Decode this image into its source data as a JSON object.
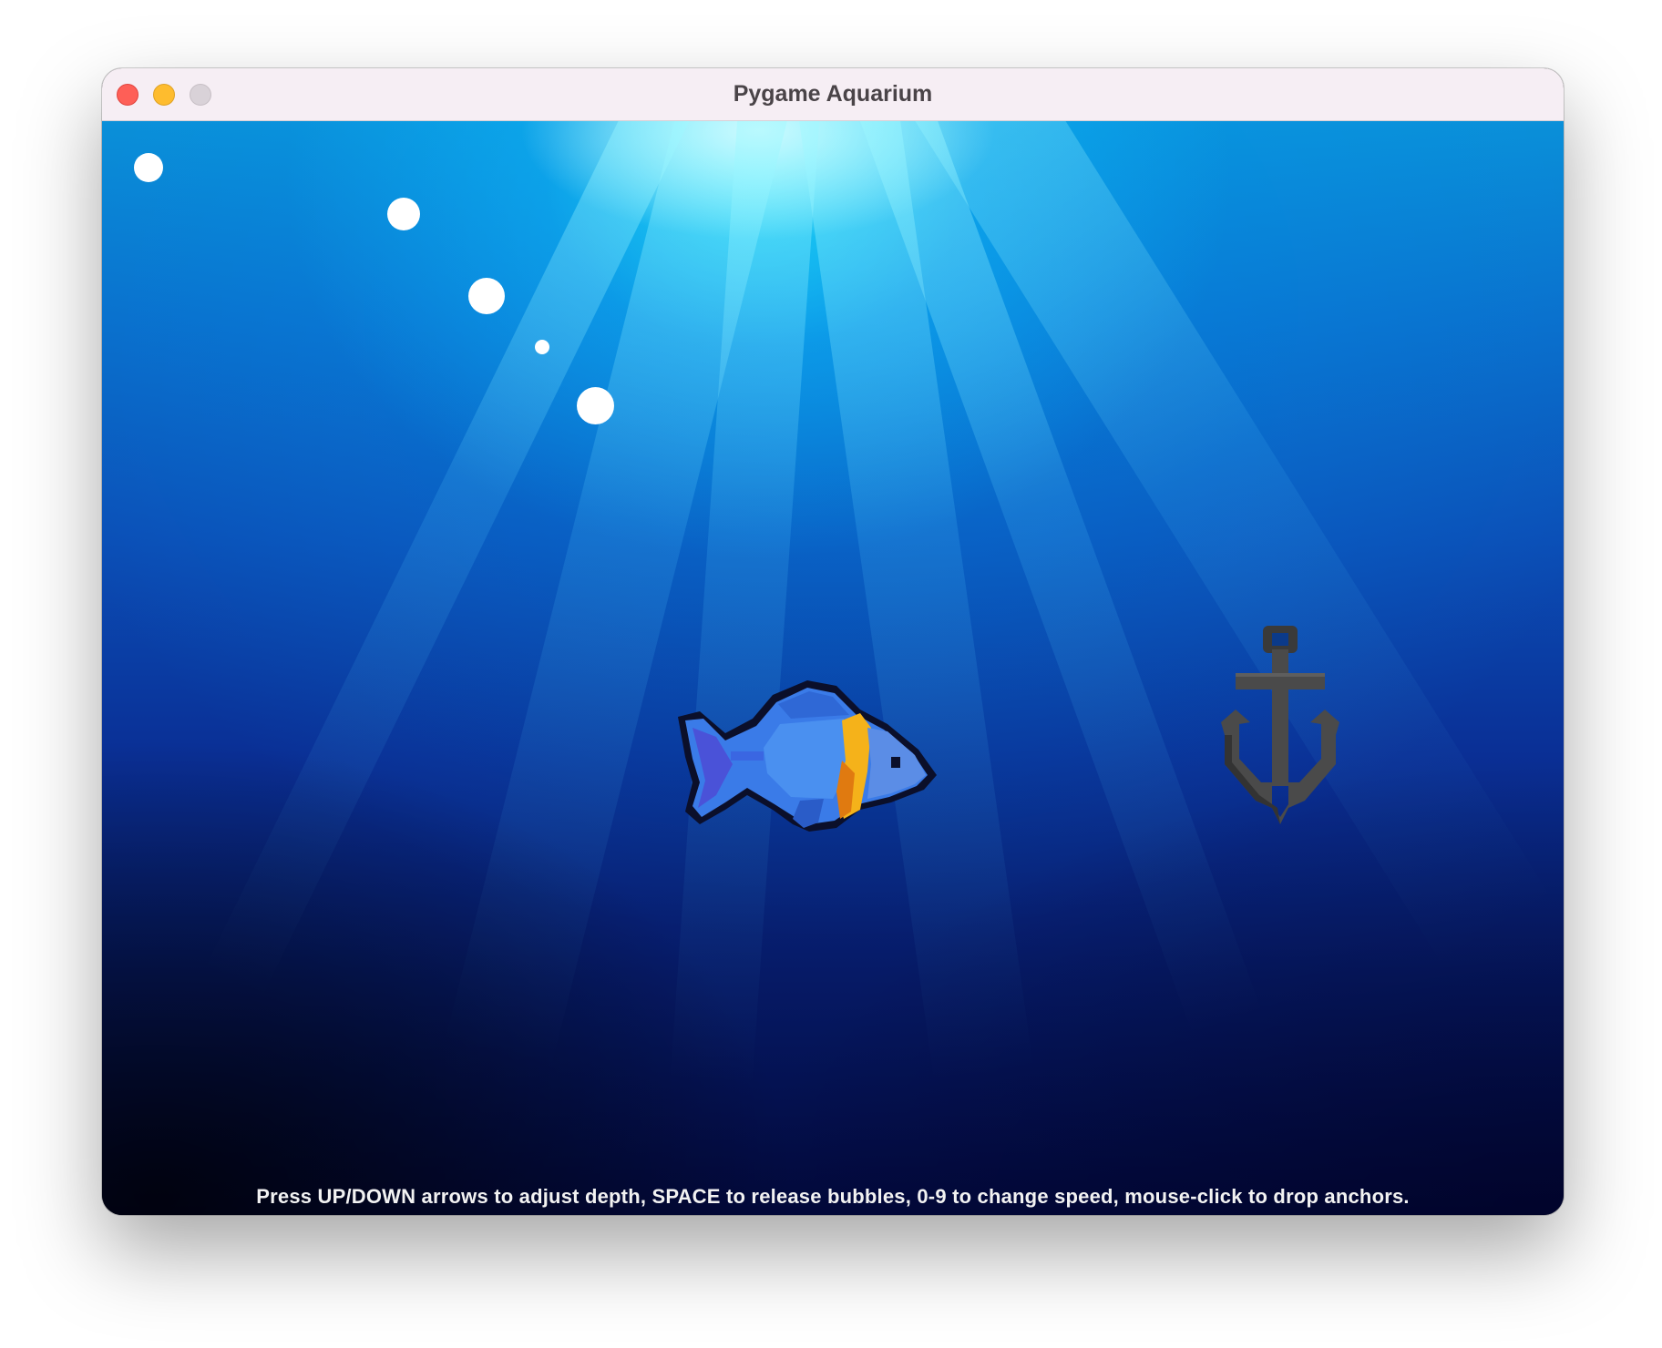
{
  "window": {
    "title": "Pygame Aquarium"
  },
  "scene": {
    "colors": {
      "water_top": "#0a8fd8",
      "water_bottom": "#02083a",
      "light_shaft": "#28f0ff",
      "fish_body": "#3a7be8",
      "fish_stripe": "#f5b21a",
      "anchor": "#4a4a4a"
    },
    "sprites": {
      "fish": "fish-icon",
      "anchor": "anchor-icon",
      "bubble_count": 5
    }
  },
  "status": {
    "instructions": "Press UP/DOWN arrows to adjust depth, SPACE to release bubbles, 0-9 to change speed, mouse-click to drop anchors."
  }
}
